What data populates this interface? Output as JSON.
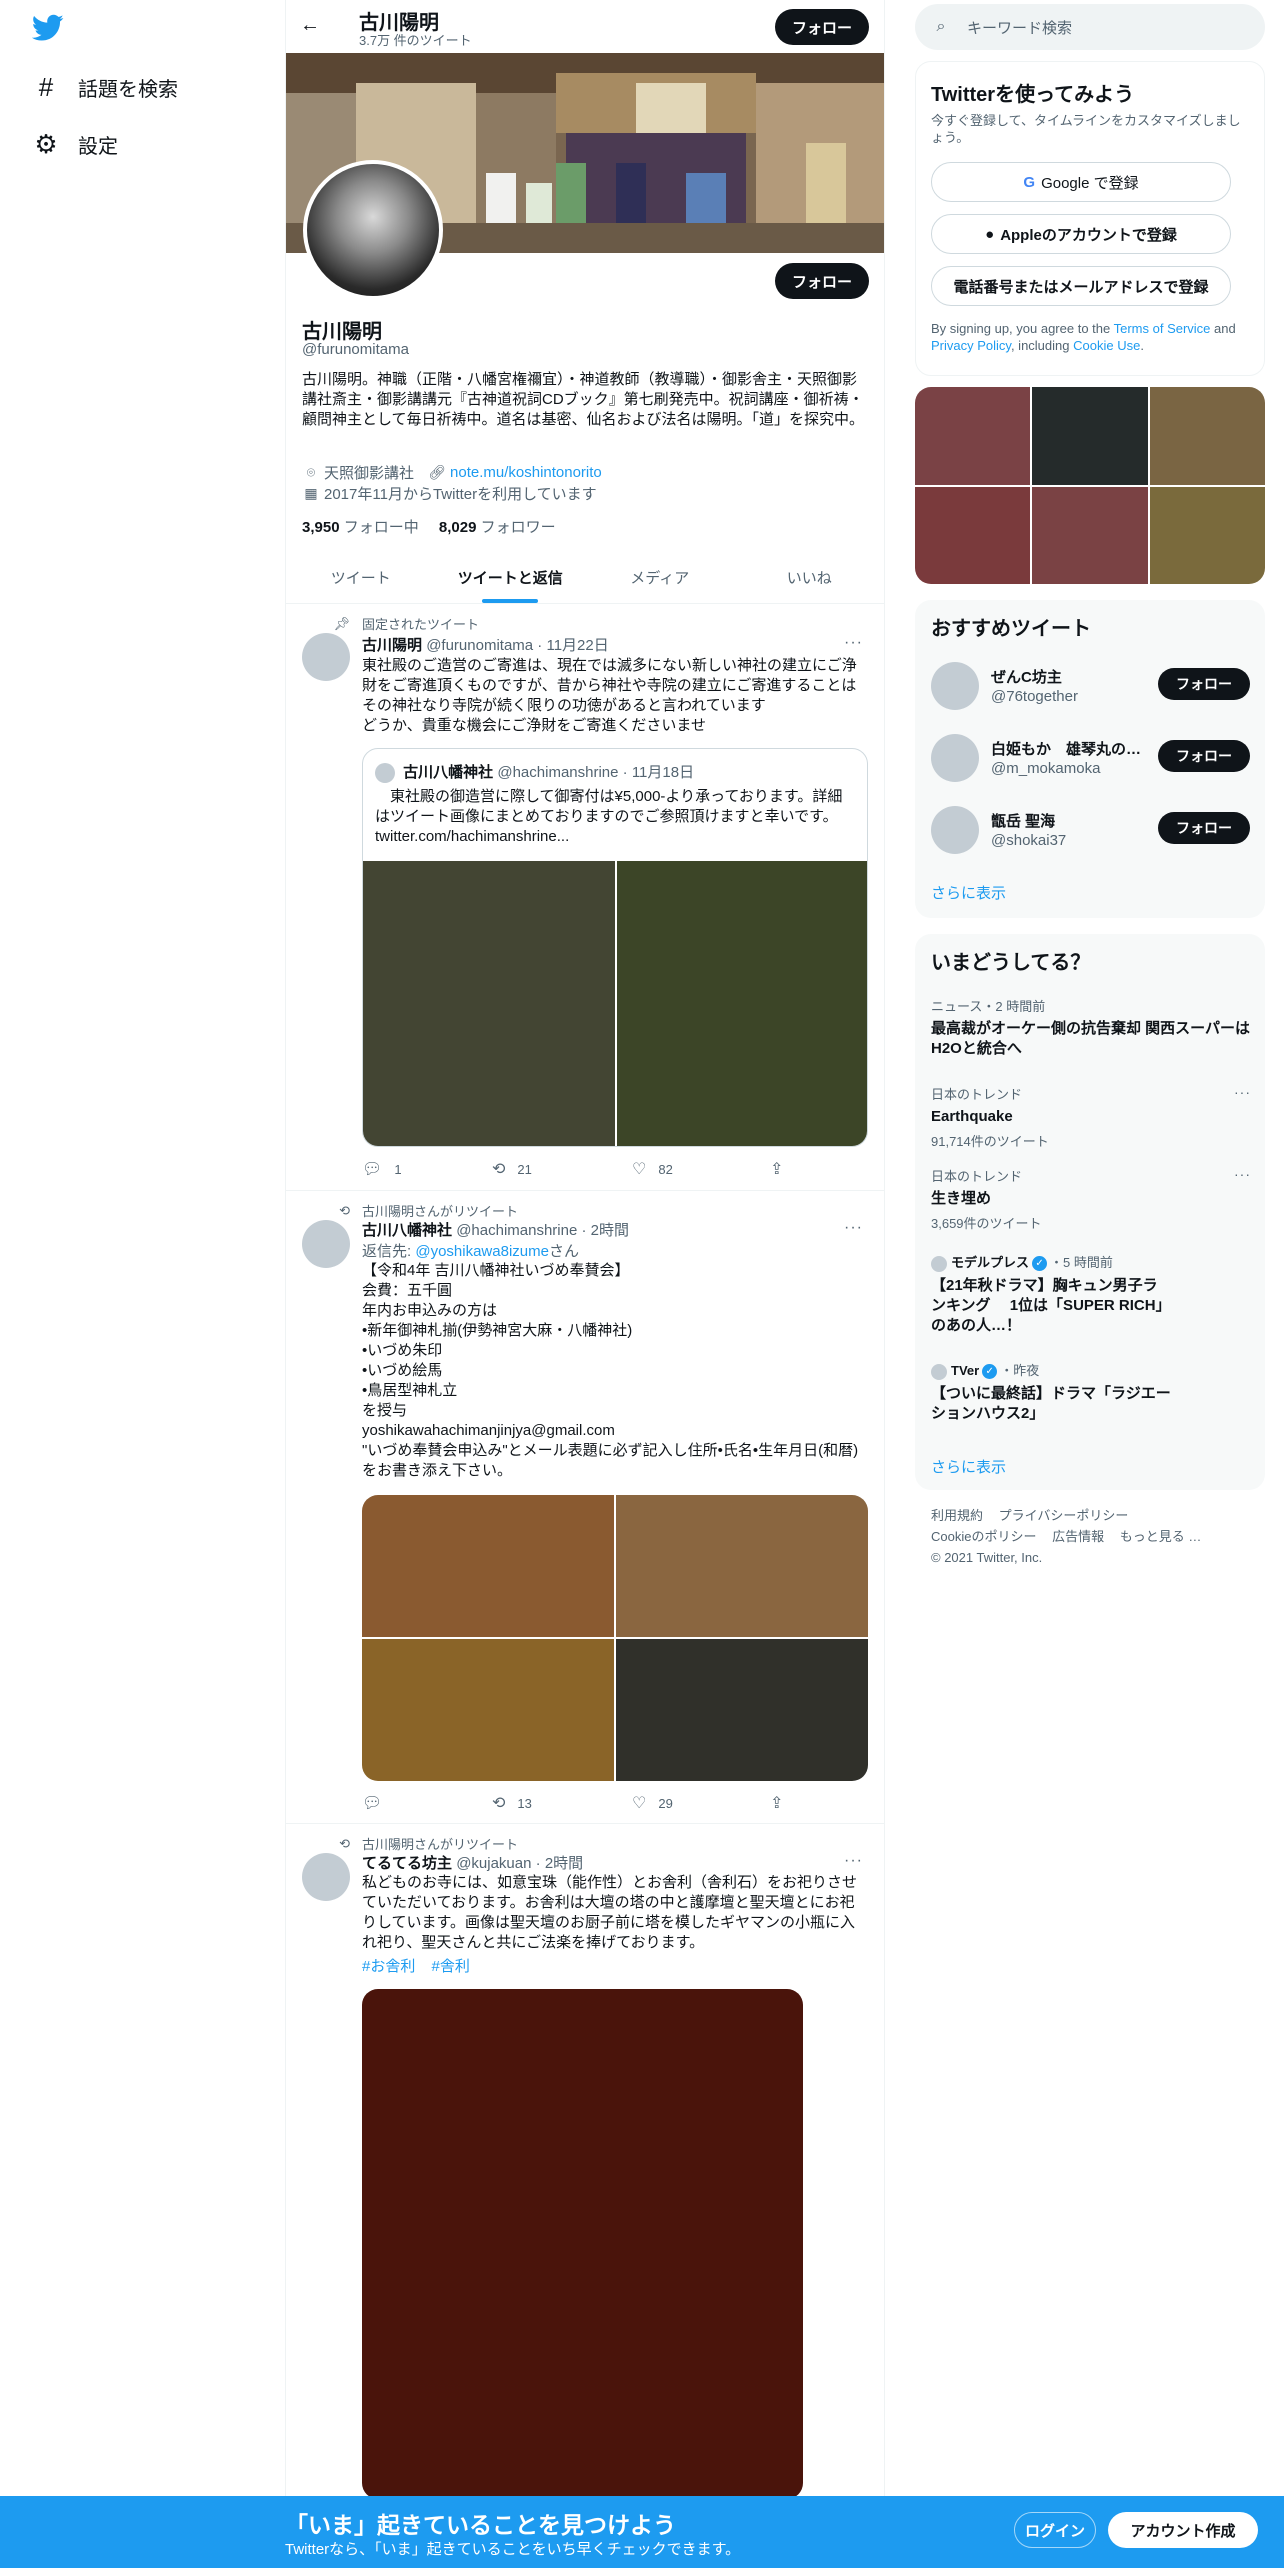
{
  "nav": {
    "items": [
      {
        "label": "話題を検索",
        "icon": "hashtag-icon",
        "glyph": "#"
      },
      {
        "label": "設定",
        "icon": "gear-icon",
        "glyph": "⚙"
      }
    ]
  },
  "header": {
    "back_glyph": "←",
    "title": "古川陽明",
    "subtitle": "3.7万 件のツイート",
    "follow_label": "フォロー"
  },
  "profile": {
    "name": "古川陽明",
    "handle": "@furunomitama",
    "follow_label": "フォロー",
    "bio": "古川陽明。神職（正階・八幡宮権禰宜）・神道教師（教導職）・御影舎主・天照御影講社斎主・御影講講元『古神道祝詞CDブック』第七刷発売中。祝詞講座・御祈祷・顧問神主として毎日祈祷中。道名は基密、仙名および法名は陽明。「道」を探究中。",
    "location": "天照御影講社",
    "url": "note.mu/koshintonorito",
    "joined": "2017年11月からTwitterを利用しています",
    "following_count": "3,950",
    "following_label": "フォロー中",
    "followers_count": "8,029",
    "followers_label": "フォロワー"
  },
  "tabs": [
    {
      "label": "ツイート",
      "active": false
    },
    {
      "label": "ツイートと返信",
      "active": true
    },
    {
      "label": "メディア",
      "active": false
    },
    {
      "label": "いいね",
      "active": false
    }
  ],
  "tweets": [
    {
      "context": "固定されたツイート",
      "context_icon": "pin-icon",
      "name": "古川陽明",
      "handle": "@furunomitama",
      "time": "11月22日",
      "text": "東社殿のご造営のご寄進は、現在では滅多にない新しい神社の建立にご浄財をご寄進頂くものですが、昔から神社や寺院の建立にご寄進することはその神社なり寺院が続く限りの功徳があると言われています\nどうか、貴重な機会にご浄財をご寄進くださいませ",
      "quote": {
        "name": "古川八幡神社",
        "handle": "@hachimanshrine",
        "time": "11月18日",
        "text": "　東社殿の御造営に際して御寄付は¥5,000-より承っております。詳細はツイート画像にまとめておりますのでご参照頂けますと幸いです。\ntwitter.com/hachimanshrine..."
      },
      "replies": "1",
      "retweets": "21",
      "likes": "82"
    },
    {
      "context": "古川陽明さんがリツイート",
      "context_icon": "retweet-icon",
      "name": "古川八幡神社",
      "handle": "@hachimanshrine",
      "time": "2時間",
      "reply_prefix": "返信先: ",
      "reply_to": "@yoshikawa8izume",
      "reply_suffix": "さん",
      "text": "【令和4年 吉川八幡神社いづめ奉賛会】\n会費：五千圓\n年内お申込みの方は\n•新年御神札揃(伊勢神宮大麻・八幡神社)\n•いづめ朱印\n•いづめ絵馬\n•鳥居型神札立\nを授与\nyoshikawahachimanjinjya@gmail.com\n\"いづめ奉賛会申込み\"とメール表題に必ず記入し住所•氏名•生年月日(和暦)をお書き添え下さい。",
      "replies": "",
      "retweets": "13",
      "likes": "29"
    },
    {
      "context": "古川陽明さんがリツイート",
      "context_icon": "retweet-icon",
      "name": "てるてる坊主",
      "handle": "@kujakuan",
      "time": "2時間",
      "text": "私どものお寺には、如意宝珠（能作性）とお舎利（舎利石）をお祀りさせていただいております。お舎利は大壇の塔の中と護摩壇と聖天壇とにお祀りしています。画像は聖天壇のお厨子前に塔を模したギヤマンの小瓶に入れ祀り、聖天さんと共にご法楽を捧げております。",
      "hashtags": [
        "#お舎利",
        "#舎利"
      ]
    }
  ],
  "search": {
    "placeholder": "キーワード検索"
  },
  "signup_card": {
    "title": "Twitterを使ってみよう",
    "subtitle": "今すぐ登録して、タイムラインをカスタマイズしましょう。",
    "google": "Google で登録",
    "apple": "Appleのアカウントで登録",
    "phone": "電話番号またはメールアドレスで登録",
    "legal_prefix": "By signing up, you agree to the ",
    "terms": "Terms of Service",
    "legal_and": " and ",
    "privacy": "Privacy Policy",
    "legal_including": ", including ",
    "cookie": "Cookie Use",
    "legal_end": "."
  },
  "recommended": {
    "title": "おすすめツイート",
    "follow_label": "フォロー",
    "users": [
      {
        "name": "ぜんC坊主",
        "handle": "@76together"
      },
      {
        "name": "白姫もか　雄琴丸の…",
        "handle": "@m_mokamoka"
      },
      {
        "name": "甑岳 聖海",
        "handle": "@shokai37"
      }
    ],
    "more": "さらに表示"
  },
  "trends": {
    "title": "いまどうしてる？",
    "items": [
      {
        "category": "ニュース・2 時間前",
        "title": "最高裁がオーケー側の抗告棄却 関西スーパーはH2Oと統合へ",
        "count": ""
      },
      {
        "category": "日本のトレンド",
        "title": "Earthquake",
        "count": "91,714件のツイート"
      },
      {
        "category": "日本のトレンド",
        "title": "生き埋め",
        "count": "3,659件のツイート"
      },
      {
        "source": "モデルプレス",
        "time": "・5 時間前",
        "title": "【21年秋ドラマ】胸キュン男子ランキング　 1位は「SUPER RICH」のあの人…！"
      },
      {
        "source": "TVer",
        "time": "・昨夜",
        "title": "【ついに最終話】ドラマ「ラジエーションハウス2」"
      }
    ],
    "more": "さらに表示"
  },
  "footer": {
    "links": [
      "利用規約",
      "プライバシーポリシー",
      "Cookieのポリシー",
      "広告情報",
      "もっと見る …"
    ],
    "copyright": "© 2021 Twitter, Inc."
  },
  "bottom_bar": {
    "title": "「いま」起きていることを見つけよう",
    "subtitle": "Twitterなら、「いま」起きていることをいち早くチェックできます。",
    "login": "ログイン",
    "signup": "アカウント作成"
  },
  "colors": {
    "accent": "#1d9bf0",
    "text": "#0f1419",
    "muted": "#536471",
    "bottom_bar": "#1d9bf0"
  }
}
